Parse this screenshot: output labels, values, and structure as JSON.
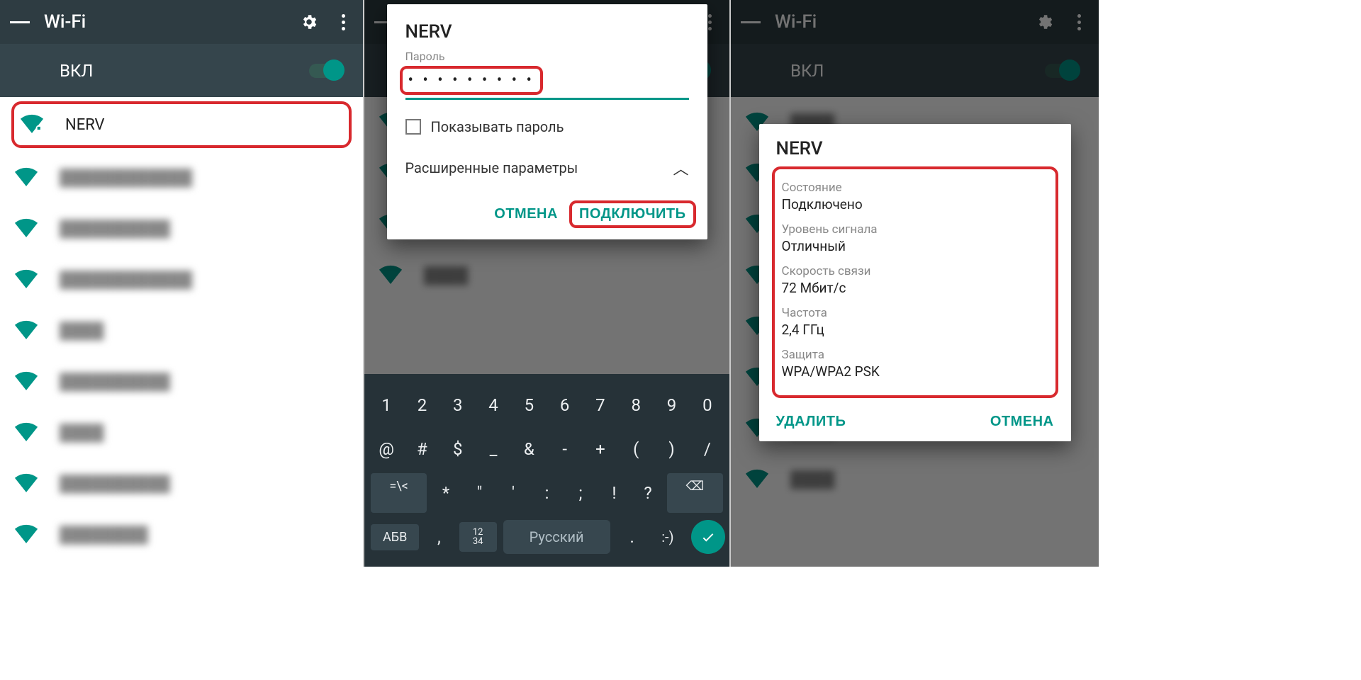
{
  "colors": {
    "accent": "#009688",
    "highlight": "#d8292e"
  },
  "appbar": {
    "title": "Wi-Fi"
  },
  "toggle": {
    "label": "ВКЛ",
    "on": true
  },
  "networks": [
    {
      "name": "NERV",
      "highlighted": true
    }
  ],
  "blurred_count": 8,
  "connect_dialog": {
    "title": "NERV",
    "password_label": "Пароль",
    "password_masked": "• • • • • • • • •",
    "show_password_label": "Показывать пароль",
    "advanced_label": "Расширенные параметры",
    "cancel": "ОТМЕНА",
    "connect": "ПОДКЛЮЧИТЬ"
  },
  "keyboard": {
    "row1": [
      "1",
      "2",
      "3",
      "4",
      "5",
      "6",
      "7",
      "8",
      "9",
      "0"
    ],
    "row2": [
      "@",
      "#",
      "$",
      "_",
      "&",
      "-",
      "+",
      "(",
      ")",
      "/"
    ],
    "row3_lead": "=\\<",
    "row3": [
      "*",
      "\"",
      "'",
      ":",
      ";",
      "!",
      "?"
    ],
    "row3_back": "⌫",
    "row4_abc": "АБВ",
    "row4_num": "12\n34",
    "row4_comma": ",",
    "row4_space": "Русский",
    "row4_dot": ".",
    "row4_emoji": ":-)"
  },
  "details_dialog": {
    "title": "NERV",
    "rows": [
      {
        "label": "Состояние",
        "value": "Подключено"
      },
      {
        "label": "Уровень сигнала",
        "value": "Отличный"
      },
      {
        "label": "Скорость связи",
        "value": "72 Мбит/с"
      },
      {
        "label": "Частота",
        "value": "2,4 ГГц"
      },
      {
        "label": "Защита",
        "value": "WPA/WPA2 PSK"
      }
    ],
    "forget": "УДАЛИТЬ",
    "cancel": "ОТМЕНА"
  }
}
